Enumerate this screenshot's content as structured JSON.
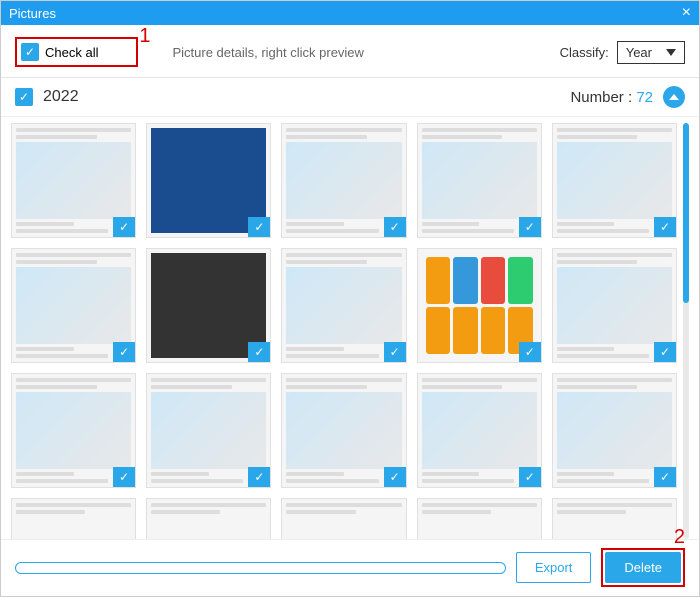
{
  "window": {
    "title": "Pictures"
  },
  "toolbar": {
    "check_all_label": "Check all",
    "hint": "Picture details, right click preview",
    "classify_label": "Classify:",
    "classify_value": "Year"
  },
  "section": {
    "year": "2022",
    "number_label": "Number :",
    "number_value": "72"
  },
  "annotations": {
    "one": "1",
    "two": "2"
  },
  "buttons": {
    "export": "Export",
    "delete": "Delete"
  },
  "thumbs": [
    {
      "kind": "list"
    },
    {
      "kind": "desktop"
    },
    {
      "kind": "list"
    },
    {
      "kind": "list"
    },
    {
      "kind": "list"
    },
    {
      "kind": "list"
    },
    {
      "kind": "screen"
    },
    {
      "kind": "list"
    },
    {
      "kind": "apps"
    },
    {
      "kind": "list"
    },
    {
      "kind": "list"
    },
    {
      "kind": "list"
    },
    {
      "kind": "list"
    },
    {
      "kind": "list"
    },
    {
      "kind": "list"
    }
  ]
}
